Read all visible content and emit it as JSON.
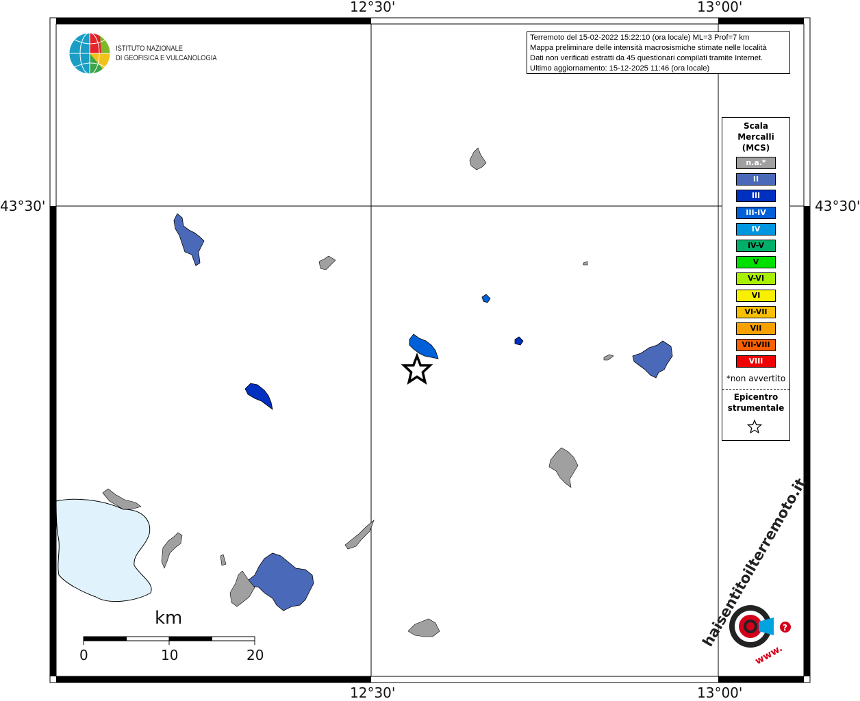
{
  "map": {
    "coords": {
      "top_left_lon": "12°30'",
      "top_right_lon": "13°00'",
      "bottom_left_lon": "12°30'",
      "bottom_right_lon": "13°00'",
      "left_lat": "43°30'",
      "right_lat": "43°30'"
    },
    "logo": {
      "line1": "ISTITUTO NAZIONALE",
      "line2": "DI GEOFISICA E VULCANOLOGIA"
    },
    "info": {
      "line1": "Terremoto del 15-02-2022 15:22:10 (ora locale) ML=3 Prof=7 km",
      "line2": "Mappa preliminare delle intensità macrosismiche stimate nelle località",
      "line3": "Dati non verificati estratti da 45 questionari compilati tramite Internet.",
      "line4": "Ultimo aggiornamento: 15-12-2025 11:46 (ora locale)"
    },
    "legend": {
      "title_line1": "Scala",
      "title_line2": "Mercalli",
      "title_line3": "(MCS)",
      "items": [
        {
          "label": "n.a.*",
          "color": "#a0a0a0",
          "text_color": "#ffffff"
        },
        {
          "label": "II",
          "color": "#4a69b8",
          "text_color": "#ffffff"
        },
        {
          "label": "III",
          "color": "#0030c0",
          "text_color": "#ffffff"
        },
        {
          "label": "III-IV",
          "color": "#0060d8",
          "text_color": "#ffffff"
        },
        {
          "label": "IV",
          "color": "#0096e0",
          "text_color": "#ffffff"
        },
        {
          "label": "IV-V",
          "color": "#00b06a",
          "text_color": "#000000"
        },
        {
          "label": "V",
          "color": "#00e000",
          "text_color": "#000000"
        },
        {
          "label": "V-VI",
          "color": "#a8f000",
          "text_color": "#000000"
        },
        {
          "label": "VI",
          "color": "#f8f000",
          "text_color": "#000000"
        },
        {
          "label": "VI-VII",
          "color": "#f8c000",
          "text_color": "#000000"
        },
        {
          "label": "VII",
          "color": "#f8a000",
          "text_color": "#000000"
        },
        {
          "label": "VII-VIII",
          "color": "#f86000",
          "text_color": "#000000"
        },
        {
          "label": "VIII",
          "color": "#f00000",
          "text_color": "#ffffff"
        }
      ],
      "note": "*non avvertito",
      "epicentre_line1": "Epicentro",
      "epicentre_line2": "strumentale"
    },
    "scale_bar": {
      "unit": "km",
      "ticks": [
        "0",
        "10",
        "20"
      ]
    },
    "brand": {
      "text_top": "haisentitoilterremoto.it",
      "text_bottom": "www.",
      "question": "?"
    },
    "colors": {
      "na": "#a0a0a0",
      "II": "#4a69b8",
      "III": "#0030c0",
      "III_IV": "#0060d8",
      "IV": "#0096e0",
      "lake": "#e0f2fc"
    }
  }
}
